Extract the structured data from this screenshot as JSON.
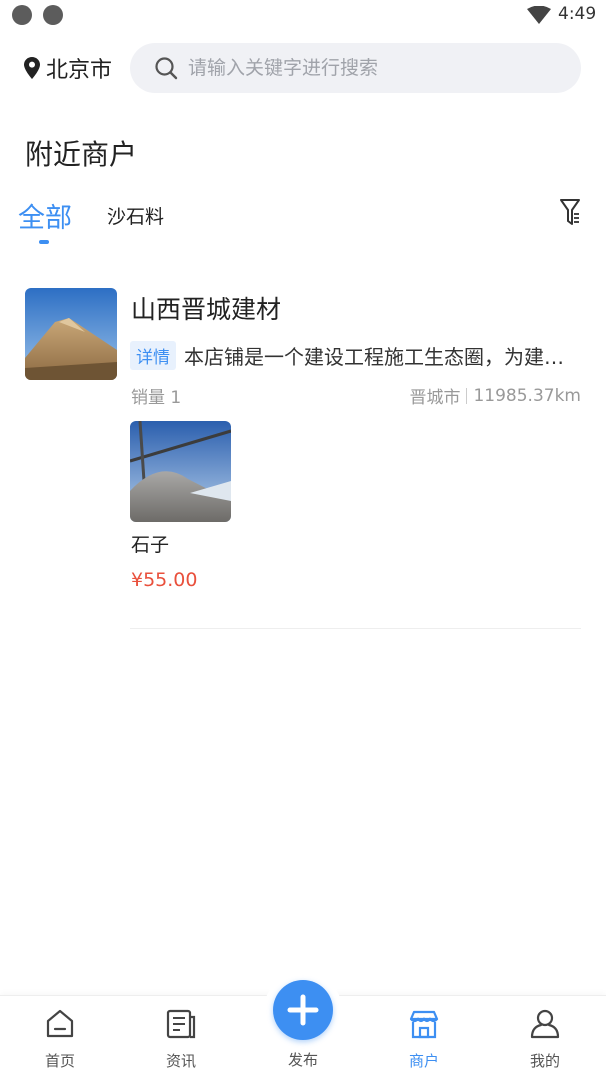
{
  "status_bar": {
    "time": "4:49"
  },
  "header": {
    "location": "北京市",
    "search_placeholder": "请输入关键字进行搜索"
  },
  "section_title": "附近商户",
  "tabs": [
    {
      "label": "全部",
      "active": true
    },
    {
      "label": "沙石料",
      "active": false
    }
  ],
  "merchants": [
    {
      "name": "山西晋城建材",
      "detail_tag": "详情",
      "description": "本店铺是一个建设工程施工生态圈，为建设工程施工提供一站式服务",
      "sales": "销量 1",
      "city": "晋城市",
      "distance": "11985.37km",
      "products": [
        {
          "name": "石子",
          "price": "¥55.00"
        }
      ]
    }
  ],
  "bottom_nav": {
    "items": [
      {
        "label": "首页",
        "icon": "home-icon",
        "active": false
      },
      {
        "label": "资讯",
        "icon": "news-icon",
        "active": false
      },
      {
        "label": "发布",
        "icon": "plus-icon",
        "active": false
      },
      {
        "label": "商户",
        "icon": "store-icon",
        "active": true
      },
      {
        "label": "我的",
        "icon": "user-icon",
        "active": false
      }
    ]
  },
  "colors": {
    "accent": "#3d8ff2",
    "price": "#e9503c",
    "search_bg": "#f0f1f5"
  }
}
